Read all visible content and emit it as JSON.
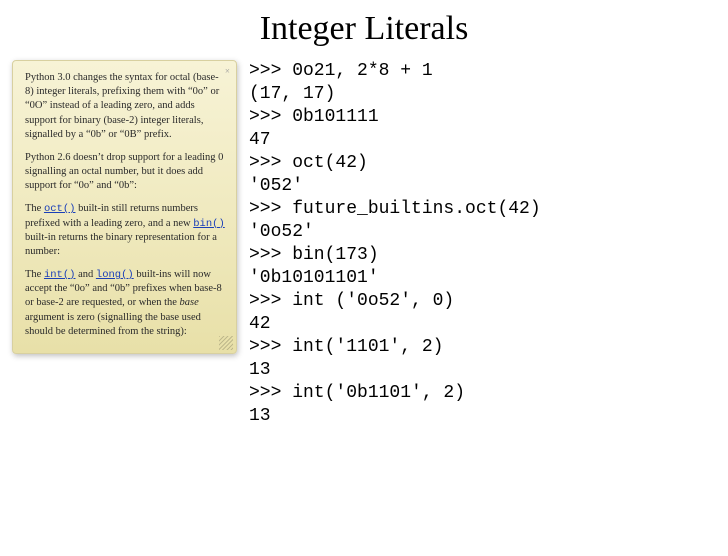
{
  "title": "Integer Literals",
  "note": {
    "p1a": "Python 3.0 changes the syntax for octal (base-8) integer literals, prefixing them with “0o” or “0O” instead of a leading zero, and adds support for binary (base-2) integer literals, signalled by a “0b” or “0B” prefix.",
    "p2a": "Python 2.6 doesn’t drop support for a leading 0 signalling an octal number, but it does add support for “0o” and “0b”:",
    "p3": {
      "a": "The ",
      "fn_oct": "oct()",
      "b": " built-in still returns numbers prefixed with a leading zero, and a new ",
      "fn_bin": "bin()",
      "c": " built-in returns the binary representation for a number:"
    },
    "p4": {
      "a": "The ",
      "fn_int": "int()",
      "b": " and ",
      "fn_long": "long()",
      "c": " built-ins will now accept the “0o” and “0b” prefixes when base-8 or base-2 are requested, or when the ",
      "em": "base",
      "d": " argument is zero (signalling the base used should be determined from the string):"
    }
  },
  "code": ">>> 0o21, 2*8 + 1\n(17, 17)\n>>> 0b101111\n47\n>>> oct(42)\n'052'\n>>> future_builtins.oct(42)\n'0o52'\n>>> bin(173)\n'0b10101101'\n>>> int ('0o52', 0)\n42\n>>> int('1101', 2)\n13\n>>> int('0b1101', 2)\n13"
}
